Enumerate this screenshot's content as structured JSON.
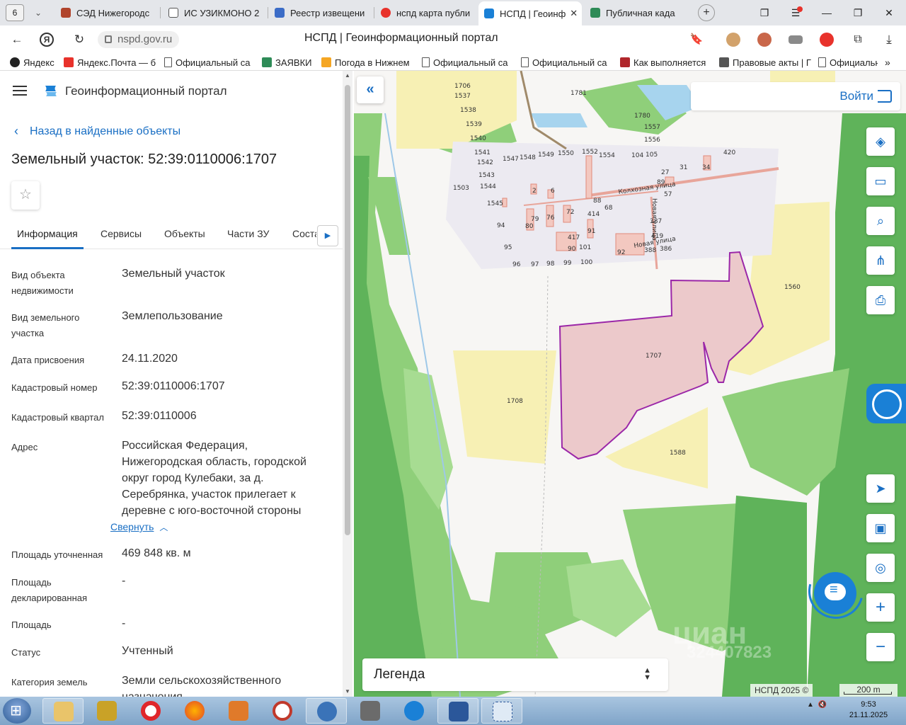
{
  "browser": {
    "tab_count": "6",
    "tabs": [
      {
        "label": "СЭД Нижегородс",
        "color": "#b0442c"
      },
      {
        "label": "ИС УЗИКМОНО 2",
        "color": "#555555"
      },
      {
        "label": "Реестр извещени",
        "color": "#3b6cc7"
      },
      {
        "label": "нспд карта публи",
        "color": "#e8322b"
      },
      {
        "label": "НСПД | Геоинф",
        "color": "#1a80d6"
      },
      {
        "label": "Публичная када",
        "color": "#2e8b57"
      }
    ],
    "url": "nspd.gov.ru",
    "page_title": "НСПД | Геоинформационный портал",
    "bookmarks": [
      {
        "label": "Яндекс",
        "color": "#222222"
      },
      {
        "label": "Яндекс.Почта — б",
        "color": "#e8322b"
      },
      {
        "label": "Официальный са",
        "color": "doc"
      },
      {
        "label": "ЗАЯВКИ",
        "color": "#2e8b57"
      },
      {
        "label": "Погода в Нижнем",
        "color": "#f5a623"
      },
      {
        "label": "Официальный са",
        "color": "doc"
      },
      {
        "label": "Официальный са",
        "color": "doc"
      },
      {
        "label": "Как выполняется",
        "color": "#b0262b"
      },
      {
        "label": "Правовые акты | Г",
        "color": "#555555"
      },
      {
        "label": "Официальн",
        "color": "doc"
      }
    ]
  },
  "portal": {
    "name": "Геоинформационный портал",
    "back_label": "Назад в найденные объекты",
    "title": "Земельный участок: 52:39:0110006:1707",
    "tabs": [
      "Информация",
      "Сервисы",
      "Объекты",
      "Части ЗУ",
      "Соста"
    ],
    "fields": [
      {
        "label": "Вид объекта недвижимости",
        "value": "Земельный участок"
      },
      {
        "label": "Вид земельного участка",
        "value": "Землепользование"
      },
      {
        "label": "Дата присвоения",
        "value": "24.11.2020"
      },
      {
        "label": "Кадастровый номер",
        "value": "52:39:0110006:1707"
      },
      {
        "label": "Кадастровый квартал",
        "value": "52:39:0110006"
      },
      {
        "label": "Адрес",
        "value": "Российская Федерация, Нижегородская область, городской округ город Кулебаки, за д. Серебрянка, участок прилегает к деревне с юго-восточной стороны"
      },
      {
        "label": "Площадь уточненная",
        "value": "469 848 кв. м"
      },
      {
        "label": "Площадь декларированная",
        "value": "-"
      },
      {
        "label": "Площадь",
        "value": "-"
      },
      {
        "label": "Статус",
        "value": "Учтенный"
      },
      {
        "label": "Категория земель",
        "value": "Земли сельскохозяйственного назначения"
      }
    ],
    "collapse_label": "Свернуть"
  },
  "map": {
    "login_label": "Войти",
    "legend_label": "Легенда",
    "copyright": "НСПД 2025 ©",
    "scale": "200 m",
    "watermark": "циан",
    "watermark_id": "324407823",
    "selected_parcel": "1707",
    "parcel_labels": [
      "1706",
      "1537",
      "1538",
      "1539",
      "1540",
      "1541",
      "1542",
      "1543",
      "1544",
      "1545",
      "1503",
      "1547",
      "1548",
      "1549",
      "1550",
      "1552",
      "1554",
      "104",
      "105",
      "1781",
      "1780",
      "1557",
      "1556",
      "420",
      "27",
      "31",
      "34",
      "89",
      "57",
      "2",
      "6",
      "88",
      "68",
      "72",
      "414",
      "79",
      "80",
      "76",
      "417",
      "91",
      "90",
      "101",
      "94",
      "95",
      "96",
      "97",
      "98",
      "99",
      "100",
      "92",
      "387",
      "419",
      "388",
      "386",
      "1560",
      "1707",
      "1708",
      "1588"
    ],
    "street_labels": [
      "Колхозная улица",
      "Новая улица",
      "Новая улица"
    ],
    "colors": {
      "forest": "#8fcf7a",
      "forest_dark": "#5fb35a",
      "field": "#f7f0b4",
      "selected_fill": "#ecc9cb",
      "selected_stroke": "#9b27a8",
      "water": "#a7d4ee"
    }
  },
  "taskbar": {
    "time": "9:53",
    "date": "21.11.2025"
  }
}
